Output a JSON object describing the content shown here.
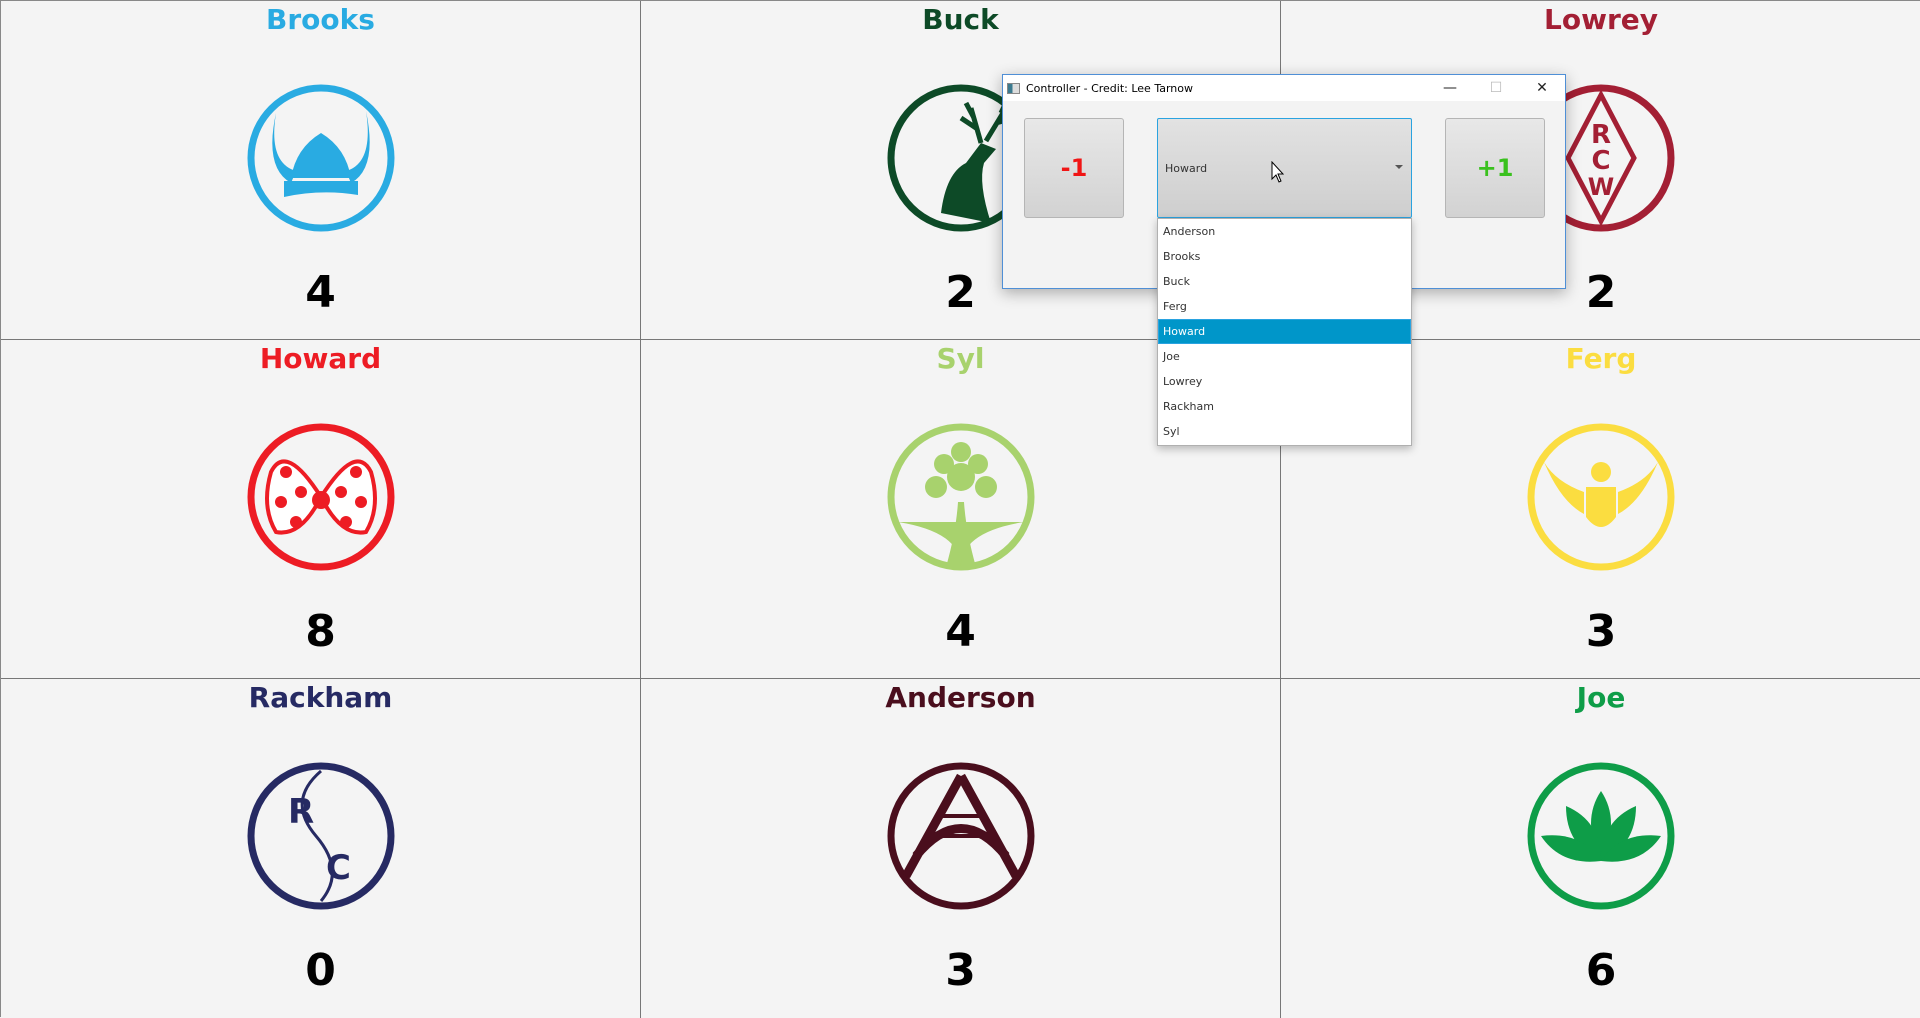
{
  "teams": [
    {
      "name": "Brooks",
      "score": "4",
      "color": "#29abe2",
      "icon": "viking-helmet"
    },
    {
      "name": "Buck",
      "score": "2",
      "color": "#0d4a27",
      "icon": "deer"
    },
    {
      "name": "Lowrey",
      "score": "2",
      "color": "#a31f34",
      "icon": "rcw-diamond"
    },
    {
      "name": "Howard",
      "score": "8",
      "color": "#ed1c24",
      "icon": "polka-dot-bow"
    },
    {
      "name": "Syl",
      "score": "4",
      "color": "#a8d26d",
      "icon": "tree"
    },
    {
      "name": "Ferg",
      "score": "3",
      "color": "#fbdd40",
      "icon": "eagle-crest"
    },
    {
      "name": "Rackham",
      "score": "0",
      "color": "#262a63",
      "icon": "rc-monogram"
    },
    {
      "name": "Anderson",
      "score": "3",
      "color": "#4a0e1d",
      "icon": "bridge"
    },
    {
      "name": "Joe",
      "score": "6",
      "color": "#0e9d48",
      "icon": "lotus"
    }
  ],
  "controller": {
    "title": "Controller - Credit: Lee Tarnow",
    "minimize": "—",
    "maximize": "☐",
    "close": "✕",
    "minus_label": "-1",
    "plus_label": "+1",
    "selected": "Howard",
    "options": [
      "Anderson",
      "Brooks",
      "Buck",
      "Ferg",
      "Howard",
      "Joe",
      "Lowrey",
      "Rackham",
      "Syl"
    ],
    "highlight_color": "#0096c9"
  }
}
